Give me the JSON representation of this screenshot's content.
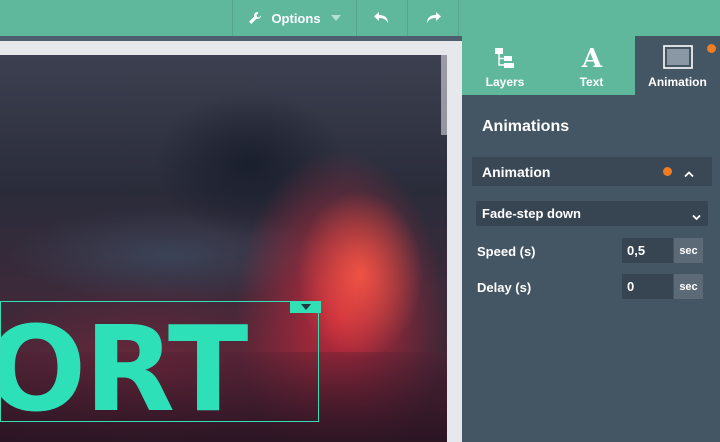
{
  "toolbar": {
    "options_label": "Options",
    "icons": [
      "wrench-icon",
      "undo-icon",
      "redo-icon",
      "chevron-down-icon"
    ]
  },
  "canvas": {
    "headline_text": "ORT"
  },
  "panel": {
    "tabs": [
      {
        "label": "Layers",
        "icon": "layers-icon"
      },
      {
        "label": "Text",
        "icon": "text-icon"
      },
      {
        "label": "Animation",
        "icon": "animation-icon",
        "active": true
      }
    ],
    "section_title": "Animations",
    "accordion": {
      "title": "Animation",
      "expanded": true
    },
    "effect": {
      "selected": "Fade-step down"
    },
    "speed": {
      "label": "Speed (s)",
      "value": "0,5",
      "unit": "sec"
    },
    "delay": {
      "label": "Delay (s)",
      "value": "0",
      "unit": "sec"
    }
  },
  "colors": {
    "accent_green": "#5fb89c",
    "panel_bg": "#445564",
    "text_cyan": "#2de0b8",
    "notification_orange": "#f07d22"
  }
}
